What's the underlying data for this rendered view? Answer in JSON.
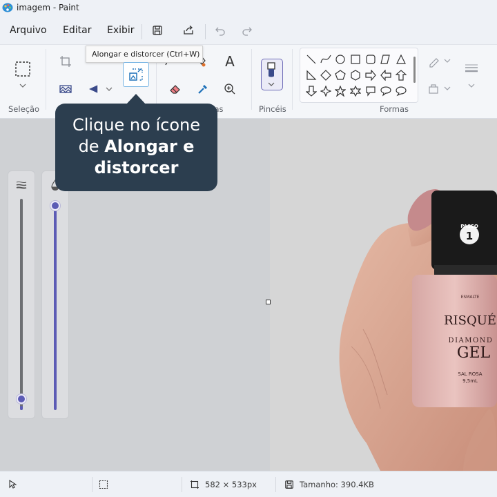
{
  "window": {
    "title": "imagem - Paint"
  },
  "menu": {
    "file": "Arquivo",
    "edit": "Editar",
    "view": "Exibir"
  },
  "ribbon": {
    "groups": {
      "selection": "Seleção",
      "tools": "tas",
      "brushes": "Pincéis",
      "shapes": "Formas"
    },
    "tooltip": "Alongar e distorcer (Ctrl+W)",
    "text_tool_glyph": "A"
  },
  "callout": {
    "line1": "Clique no ícone",
    "line2_prefix": "de ",
    "line2_bold": "Alongar e",
    "line3_bold": "distorcer"
  },
  "status": {
    "dimensions": "582 × 533px",
    "size": "Tamanho: 390.4KB"
  },
  "product": {
    "brand": "RISQUÉ",
    "top_label": "ESMALTE",
    "line1": "DIAMOND",
    "line2": "GEL",
    "shade": "SAL ROSA",
    "volume": "9,5mL",
    "step_label": "PASSO",
    "step_number": "1"
  },
  "sliders": {
    "size_level": 0.05,
    "opacity_level": 1.0
  },
  "colors": {
    "accent": "#5c5bb5",
    "callout": "#2c3e4f",
    "highlight": "#7ab6e4"
  }
}
